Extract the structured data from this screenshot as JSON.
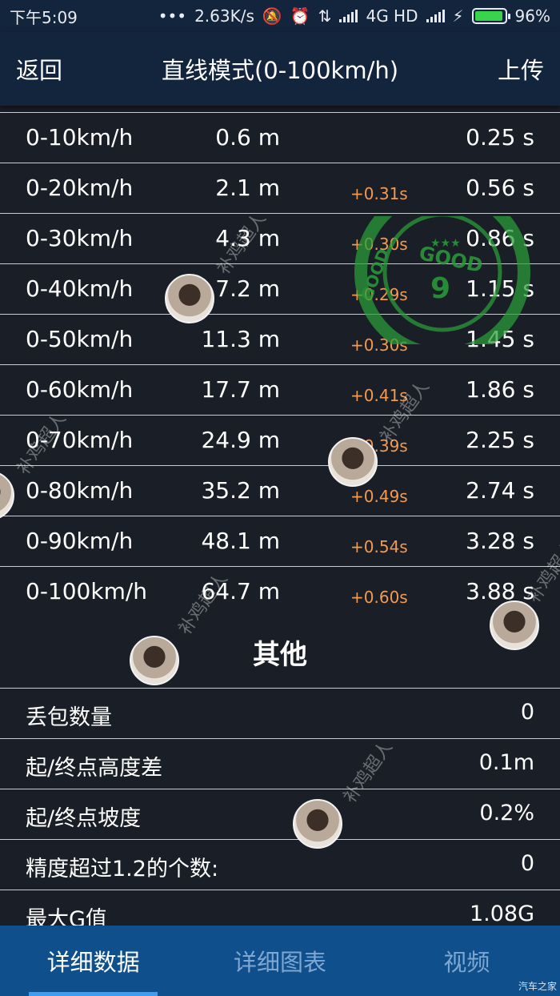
{
  "status_bar": {
    "time": "下午5:09",
    "network_speed": "2.63K/s",
    "network_type": "4G HD",
    "battery": "96%",
    "battery_level": 0.96
  },
  "nav": {
    "back_label": "返回",
    "title": "直线模式(0-100km/h)",
    "upload_label": "上传"
  },
  "speed_rows": [
    {
      "range": "0-10km/h",
      "distance": "0.6 m",
      "delta": "",
      "time": "0.25 s"
    },
    {
      "range": "0-20km/h",
      "distance": "2.1 m",
      "delta": "+0.31s",
      "time": "0.56 s"
    },
    {
      "range": "0-30km/h",
      "distance": "4.3 m",
      "delta": "+0.30s",
      "time": "0.86 s"
    },
    {
      "range": "0-40km/h",
      "distance": "7.2 m",
      "delta": "+0.29s",
      "time": "1.15 s"
    },
    {
      "range": "0-50km/h",
      "distance": "11.3 m",
      "delta": "+0.30s",
      "time": "1.45 s"
    },
    {
      "range": "0-60km/h",
      "distance": "17.7 m",
      "delta": "+0.41s",
      "time": "1.86 s"
    },
    {
      "range": "0-70km/h",
      "distance": "24.9 m",
      "delta": "+0.39s",
      "time": "2.25 s"
    },
    {
      "range": "0-80km/h",
      "distance": "35.2 m",
      "delta": "+0.49s",
      "time": "2.74 s"
    },
    {
      "range": "0-90km/h",
      "distance": "48.1 m",
      "delta": "+0.54s",
      "time": "3.28 s"
    },
    {
      "range": "0-100km/h",
      "distance": "64.7 m",
      "delta": "+0.60s",
      "time": "3.88 s"
    }
  ],
  "other": {
    "title": "其他",
    "rows": [
      {
        "label": "丢包数量",
        "value": "0"
      },
      {
        "label": "起/终点高度差",
        "value": "0.1m"
      },
      {
        "label": "起/终点坡度",
        "value": "0.2%"
      },
      {
        "label": "精度超过1.2的个数:",
        "value": "0"
      },
      {
        "label": "最大G值",
        "value": "1.08G"
      }
    ]
  },
  "tabs": [
    {
      "label": "详细数据",
      "active": true
    },
    {
      "label": "详细图表",
      "active": false
    },
    {
      "label": "视频",
      "active": false
    }
  ],
  "stamp": {
    "top_text": "GOOD",
    "number": "9",
    "side_text": "GOOD"
  },
  "watermark_text": "补鸡超人",
  "corner_mark": "汽车之家",
  "colors": {
    "background": "#1a1e26",
    "nav": "#13243d",
    "tabbar": "#0f4f8c",
    "delta": "#f29a52",
    "stamp": "#2a9d3a"
  }
}
